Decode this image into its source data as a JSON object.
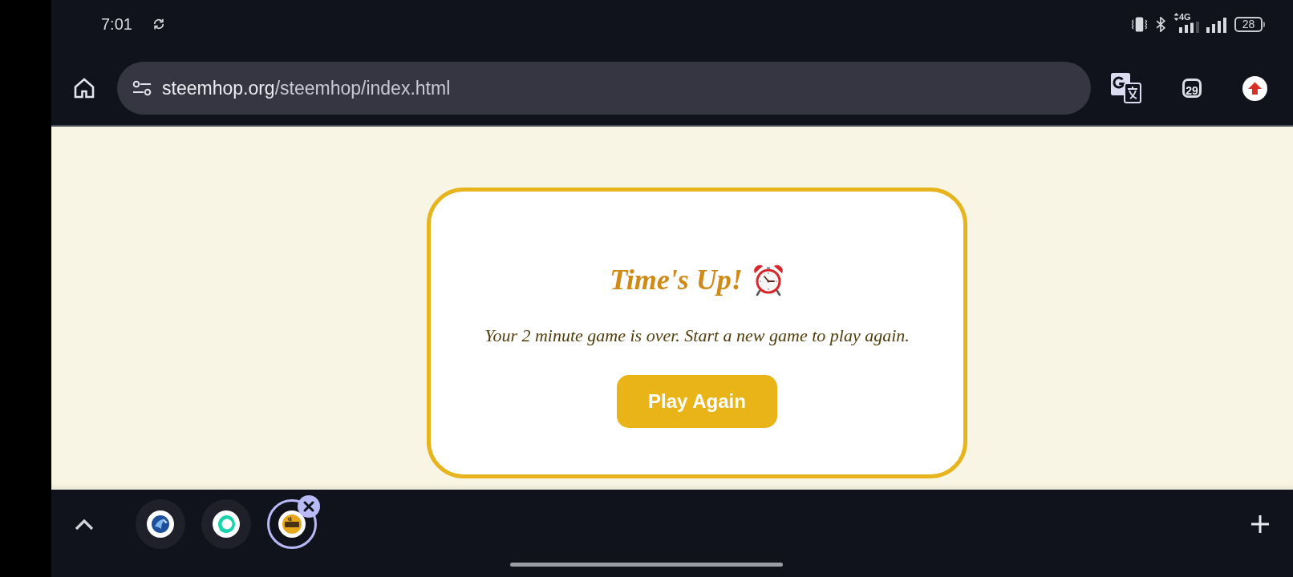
{
  "status_bar": {
    "time": "7:01",
    "network_type": "4G",
    "battery": "28"
  },
  "toolbar": {
    "url": {
      "host": "steemhop.org",
      "path": "/steemhop/index.html"
    },
    "tab_count": "29"
  },
  "dialog": {
    "title": "Time's Up!",
    "message": "Your 2 minute game is over. Start a new game to play again.",
    "button": "Play Again"
  },
  "tab_strip": {
    "tabs": [
      {
        "kind": "wave",
        "selected": false
      },
      {
        "kind": "bubble",
        "selected": false
      },
      {
        "kind": "coin",
        "selected": true
      }
    ]
  }
}
